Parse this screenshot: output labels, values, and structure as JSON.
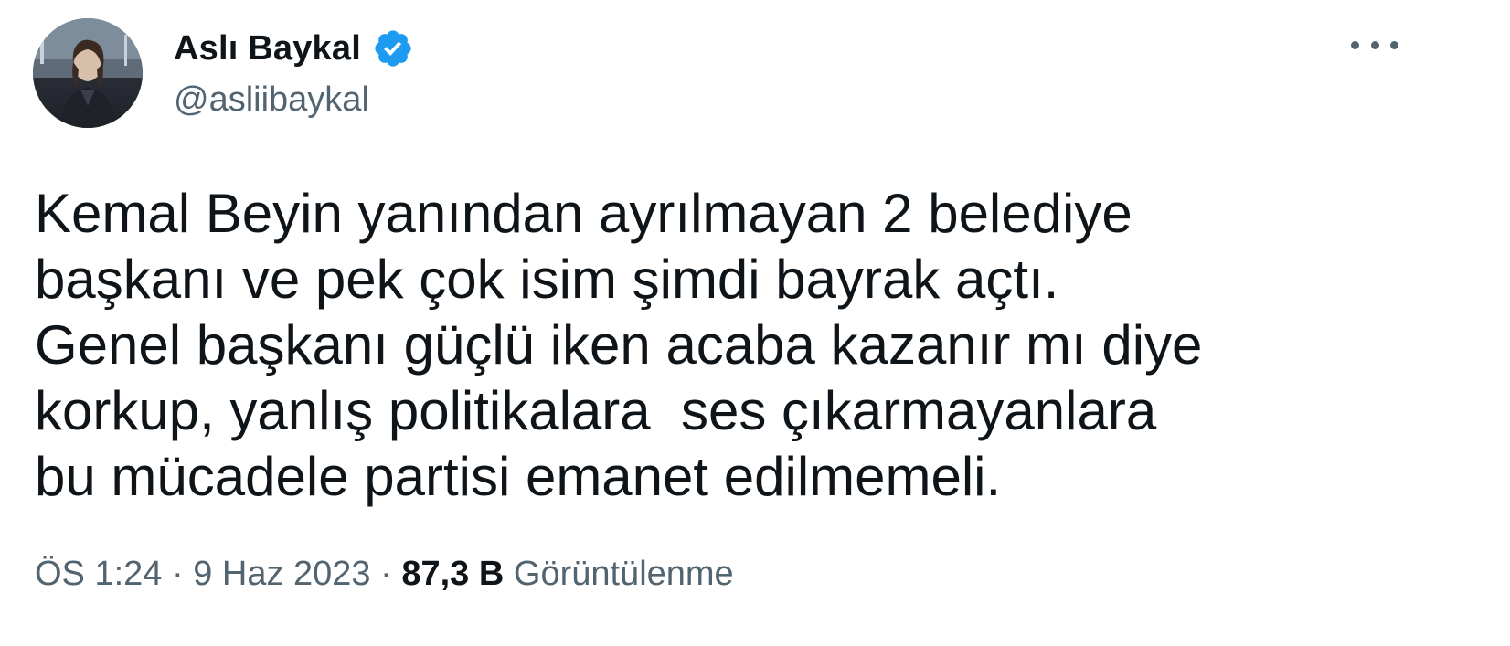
{
  "author": {
    "display_name": "Aslı Baykal",
    "handle": "@asliibaykal",
    "verified": true,
    "verified_color": "#1d9bf0"
  },
  "icons": {
    "avatar": "profile-photo",
    "verified": "verified-badge-icon",
    "more": "more-options-icon"
  },
  "tweet": {
    "text": "Kemal Beyin yanından ayrılmayan 2 belediye\nbaşkanı ve pek çok isim şimdi bayrak açtı.\nGenel başkanı güçlü iken acaba kazanır mı diye\nkorkup, yanlış politikalara  ses çıkarmayanlara\nbu mücadele partisi emanet edilmemeli."
  },
  "meta": {
    "time": "ÖS 1:24",
    "separator": "·",
    "date": "9 Haz 2023",
    "views_count": "87,3 B",
    "views_label": "Görüntülenme"
  }
}
